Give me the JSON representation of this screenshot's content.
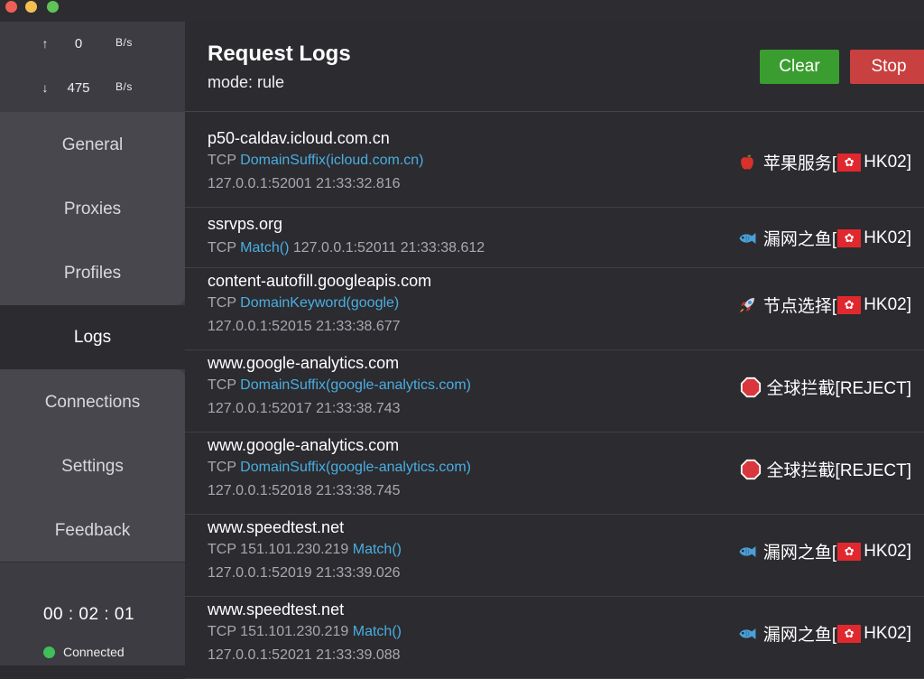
{
  "sidebar": {
    "speed_up": {
      "arrow": "↑",
      "value": "0",
      "unit": "B/s"
    },
    "speed_down": {
      "arrow": "↓",
      "value": "475",
      "unit": "B/s"
    },
    "nav": [
      {
        "label": "General"
      },
      {
        "label": "Proxies"
      },
      {
        "label": "Profiles"
      },
      {
        "label": "Logs"
      },
      {
        "label": "Connections"
      },
      {
        "label": "Settings"
      },
      {
        "label": "Feedback"
      }
    ],
    "active_nav": "Logs",
    "timer": "00 : 02 : 01",
    "status": "Connected",
    "status_color": "#3fbf59"
  },
  "header": {
    "title": "Request Logs",
    "mode": "mode: rule",
    "clear_label": "Clear",
    "stop_label": "Stop",
    "clear_color": "#3a9d2f",
    "stop_color": "#c94040"
  },
  "logs": [
    {
      "host": "p50-caldav.icloud.com.cn",
      "proto": "TCP",
      "ip": "",
      "rule": "DomainSuffix(icloud.com.cn)",
      "src": "127.0.0.1:52001 21:33:32.816",
      "policy_icon": "apple-icon",
      "policy": "苹果服务[",
      "flag": "hk-flag-icon",
      "policy_end": "HK02]"
    },
    {
      "host": "ssrvps.org",
      "proto": "TCP",
      "ip": "",
      "rule": "Match()",
      "src": "127.0.0.1:52011 21:33:38.612",
      "policy_icon": "fish-icon",
      "policy": "漏网之鱼[",
      "flag": "hk-flag-icon",
      "policy_end": "HK02]"
    },
    {
      "host": "content-autofill.googleapis.com",
      "proto": "TCP",
      "ip": "",
      "rule": "DomainKeyword(google)",
      "src": "127.0.0.1:52015 21:33:38.677",
      "policy_icon": "rocket-icon",
      "policy": "节点选择[",
      "flag": "hk-flag-icon",
      "policy_end": "HK02]"
    },
    {
      "host": "www.google-analytics.com",
      "proto": "TCP",
      "ip": "",
      "rule": "DomainSuffix(google-analytics.com)",
      "src": "127.0.0.1:52017 21:33:38.743",
      "policy_icon": "stop-sign-icon",
      "policy": "全球拦截[REJECT]",
      "flag": "",
      "policy_end": ""
    },
    {
      "host": "www.google-analytics.com",
      "proto": "TCP",
      "ip": "",
      "rule": "DomainSuffix(google-analytics.com)",
      "src": "127.0.0.1:52018 21:33:38.745",
      "policy_icon": "stop-sign-icon",
      "policy": "全球拦截[REJECT]",
      "flag": "",
      "policy_end": ""
    },
    {
      "host": "www.speedtest.net",
      "proto": "TCP",
      "ip": "151.101.230.219",
      "rule": "Match()",
      "src": "127.0.0.1:52019 21:33:39.026",
      "policy_icon": "fish-icon",
      "policy": "漏网之鱼[",
      "flag": "hk-flag-icon",
      "policy_end": "HK02]"
    },
    {
      "host": "www.speedtest.net",
      "proto": "TCP",
      "ip": "151.101.230.219",
      "rule": "Match()",
      "src": "127.0.0.1:52021 21:33:39.088",
      "policy_icon": "fish-icon",
      "policy": "漏网之鱼[",
      "flag": "hk-flag-icon",
      "policy_end": "HK02]"
    }
  ]
}
